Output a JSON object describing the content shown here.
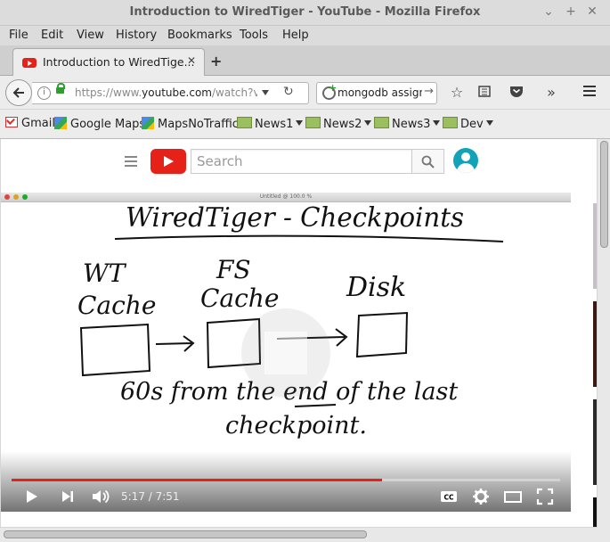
{
  "window": {
    "title": "Introduction to WiredTiger - YouTube - Mozilla Firefox"
  },
  "menu": [
    "File",
    "Edit",
    "View",
    "History",
    "Bookmarks",
    "Tools",
    "Help"
  ],
  "tab": {
    "label": "Introduction to WiredTige...",
    "close": "✕",
    "new": "+"
  },
  "nav": {
    "url_prefix": "https://www.",
    "url_host": "youtube.com",
    "url_rest": "/watch?v=C",
    "search_value": "mongodb assign"
  },
  "bookmarks": [
    {
      "label": "Gmail",
      "icon": "gmail-icon"
    },
    {
      "label": "Google Maps",
      "icon": "maps-icon"
    },
    {
      "label": "MapsNoTraffic",
      "icon": "maps-icon"
    },
    {
      "label": "News1",
      "icon": "folder-icon"
    },
    {
      "label": "News2",
      "icon": "folder-icon"
    },
    {
      "label": "News3",
      "icon": "folder-icon"
    },
    {
      "label": "Dev",
      "icon": "folder-icon"
    }
  ],
  "youtube": {
    "search_placeholder": "Search"
  },
  "video": {
    "app_title": "Untitled @ 100.0 %",
    "heading": "WiredTiger - Checkpoints",
    "box1": [
      "WT",
      "Cache"
    ],
    "box2": [
      "FS",
      "Cache"
    ],
    "box3": "Disk",
    "note_line1_a": "60s from the ",
    "note_line1_b": "end",
    "note_line1_c": " of the last",
    "note_line2": "checkpoint.",
    "time": "5:17 / 7:51",
    "progress": 0.675
  },
  "colors": {
    "accent": "#e62117",
    "avatar": "#12a3b8"
  }
}
